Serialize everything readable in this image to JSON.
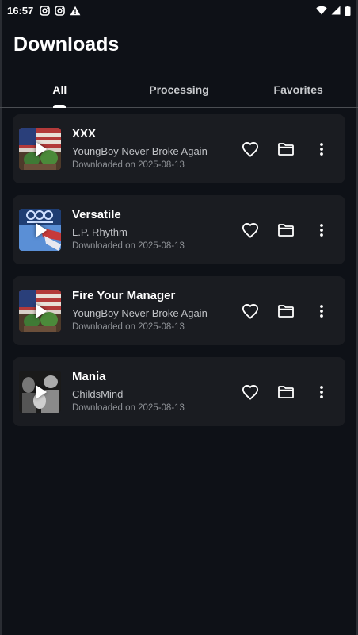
{
  "status_bar": {
    "time": "16:57",
    "left_icons": [
      "instagram-icon",
      "instagram-icon",
      "warning-icon"
    ],
    "right_icons": [
      "wifi-icon",
      "signal-icon",
      "battery-icon"
    ]
  },
  "header": {
    "title": "Downloads"
  },
  "tabs": [
    {
      "label": "All",
      "active": true
    },
    {
      "label": "Processing",
      "active": false
    },
    {
      "label": "Favorites",
      "active": false
    }
  ],
  "downloads": [
    {
      "title": "XXX",
      "artist": "YoungBoy Never Broke Again",
      "date": "Downloaded on 2025-08-13",
      "art": "flag-cover",
      "favorite": false
    },
    {
      "title": "Versatile",
      "artist": "L.P. Rhythm",
      "date": "Downloaded on 2025-08-13",
      "art": "rhythm-cover",
      "favorite": false
    },
    {
      "title": "Fire Your Manager",
      "artist": "YoungBoy Never Broke Again",
      "date": "Downloaded on 2025-08-13",
      "art": "flag-cover",
      "favorite": false
    },
    {
      "title": "Mania",
      "artist": "ChildsMind",
      "date": "Downloaded on 2025-08-13",
      "art": "bw-photo-cover",
      "favorite": false
    }
  ],
  "colors": {
    "background": "#0e1117",
    "card": "#1a1c21",
    "text_primary": "#ffffff",
    "text_secondary": "#bfc1c5",
    "text_muted": "#8e9196"
  }
}
